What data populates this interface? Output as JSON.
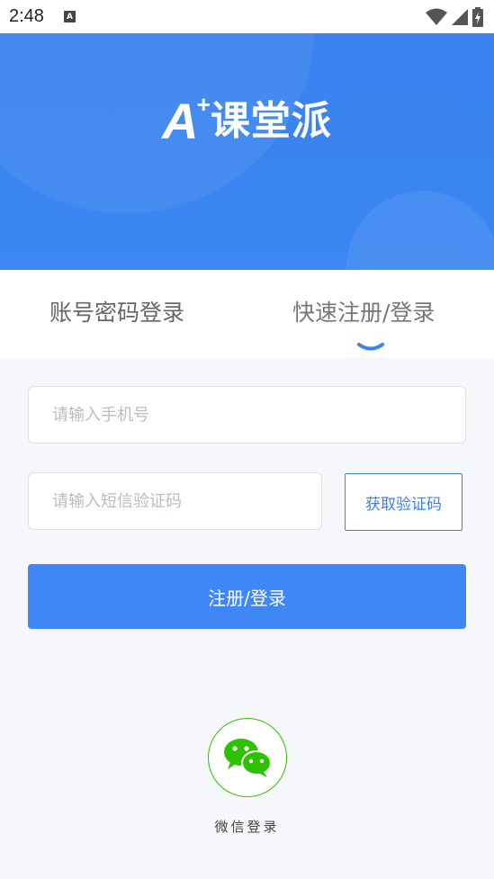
{
  "status_bar": {
    "time": "2:48",
    "notification_icon": "A",
    "icons": [
      "wifi-icon",
      "signal-icon",
      "battery-charging-icon"
    ]
  },
  "hero": {
    "logo_letter": "A",
    "logo_plus": "+",
    "logo_text": "课堂派",
    "brand_color": "#3a82ef"
  },
  "tabs": [
    {
      "label": "账号密码登录",
      "active": false
    },
    {
      "label": "快速注册/登录",
      "active": true
    }
  ],
  "form": {
    "phone_placeholder": "请输入手机号",
    "code_placeholder": "请输入短信验证码",
    "get_code_label": "获取验证码",
    "submit_label": "注册/登录"
  },
  "wechat": {
    "label": "微信登录",
    "icon": "wechat-icon",
    "color": "#2dc100"
  }
}
